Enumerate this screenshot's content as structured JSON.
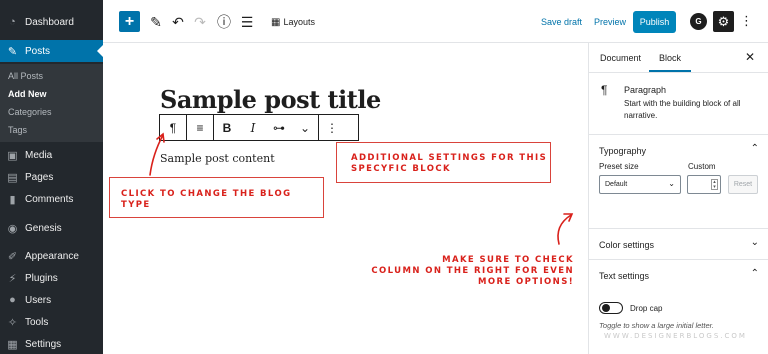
{
  "sidebar": {
    "items": [
      {
        "label": "Dashboard",
        "icon": "dashboard-icon",
        "glyph": "◔"
      },
      {
        "label": "Posts",
        "icon": "pin-icon",
        "glyph": "✎"
      },
      {
        "label": "Media",
        "icon": "media-icon",
        "glyph": "▣"
      },
      {
        "label": "Pages",
        "icon": "pages-icon",
        "glyph": "▤"
      },
      {
        "label": "Comments",
        "icon": "comments-icon",
        "glyph": "▮"
      },
      {
        "label": "Genesis",
        "icon": "genesis-icon",
        "glyph": "◉"
      },
      {
        "label": "Appearance",
        "icon": "brush-icon",
        "glyph": "✐"
      },
      {
        "label": "Plugins",
        "icon": "plugin-icon",
        "glyph": "⚡"
      },
      {
        "label": "Users",
        "icon": "user-icon",
        "glyph": "●"
      },
      {
        "label": "Tools",
        "icon": "wrench-icon",
        "glyph": "✧"
      },
      {
        "label": "Settings",
        "icon": "settings-icon",
        "glyph": "▦"
      }
    ],
    "submenu": [
      "All Posts",
      "Add New",
      "Categories",
      "Tags"
    ],
    "active_color": "#0073aa"
  },
  "topbar": {
    "layouts_label": "Layouts",
    "save_draft_label": "Save draft",
    "preview_label": "Preview",
    "publish_label": "Publish",
    "accent": "#0085ba"
  },
  "editor": {
    "title": "Sample post title",
    "content": "Sample post content"
  },
  "annotations": {
    "settings_note": "ADDITIONAL SETTINGS FOR THIS\nSPECYFIC BLOCK",
    "type_note": "CLICK TO CHANGE THE BLOG\nTYPE",
    "right_note": "MAKE SURE TO CHECK\nCOLUMN ON THE RIGHT FOR EVEN\nMORE OPTIONS!",
    "color": "#d9211b"
  },
  "panel": {
    "tab_document": "Document",
    "tab_block": "Block",
    "block_name": "Paragraph",
    "block_desc": "Start with the building block of all narrative.",
    "typography_title": "Typography",
    "preset_label": "Preset size",
    "custom_label": "Custom",
    "preset_value": "Default",
    "reset_label": "Reset",
    "color_settings_title": "Color settings",
    "text_settings_title": "Text settings",
    "drop_cap_label": "Drop cap",
    "drop_cap_help": "Toggle to show a large initial letter."
  },
  "watermark": "WWW.DESIGNERBLOGS.COM"
}
